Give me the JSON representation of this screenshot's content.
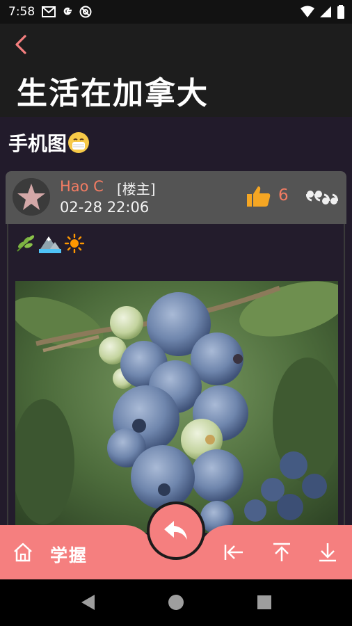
{
  "status_bar": {
    "time": "7:58"
  },
  "header": {
    "page_title": "生活在加拿大"
  },
  "topic": {
    "title": "手机图"
  },
  "post": {
    "author": "Hao C",
    "author_tag": "[楼主]",
    "time": "02-28 22:06",
    "like_count": "6"
  },
  "bottom_bar": {
    "mastery_label": "学握"
  },
  "colors": {
    "accent": "#f57f7f",
    "author_name": "#f37c63",
    "like_icon": "#f5a623",
    "background": "#221b2b"
  }
}
